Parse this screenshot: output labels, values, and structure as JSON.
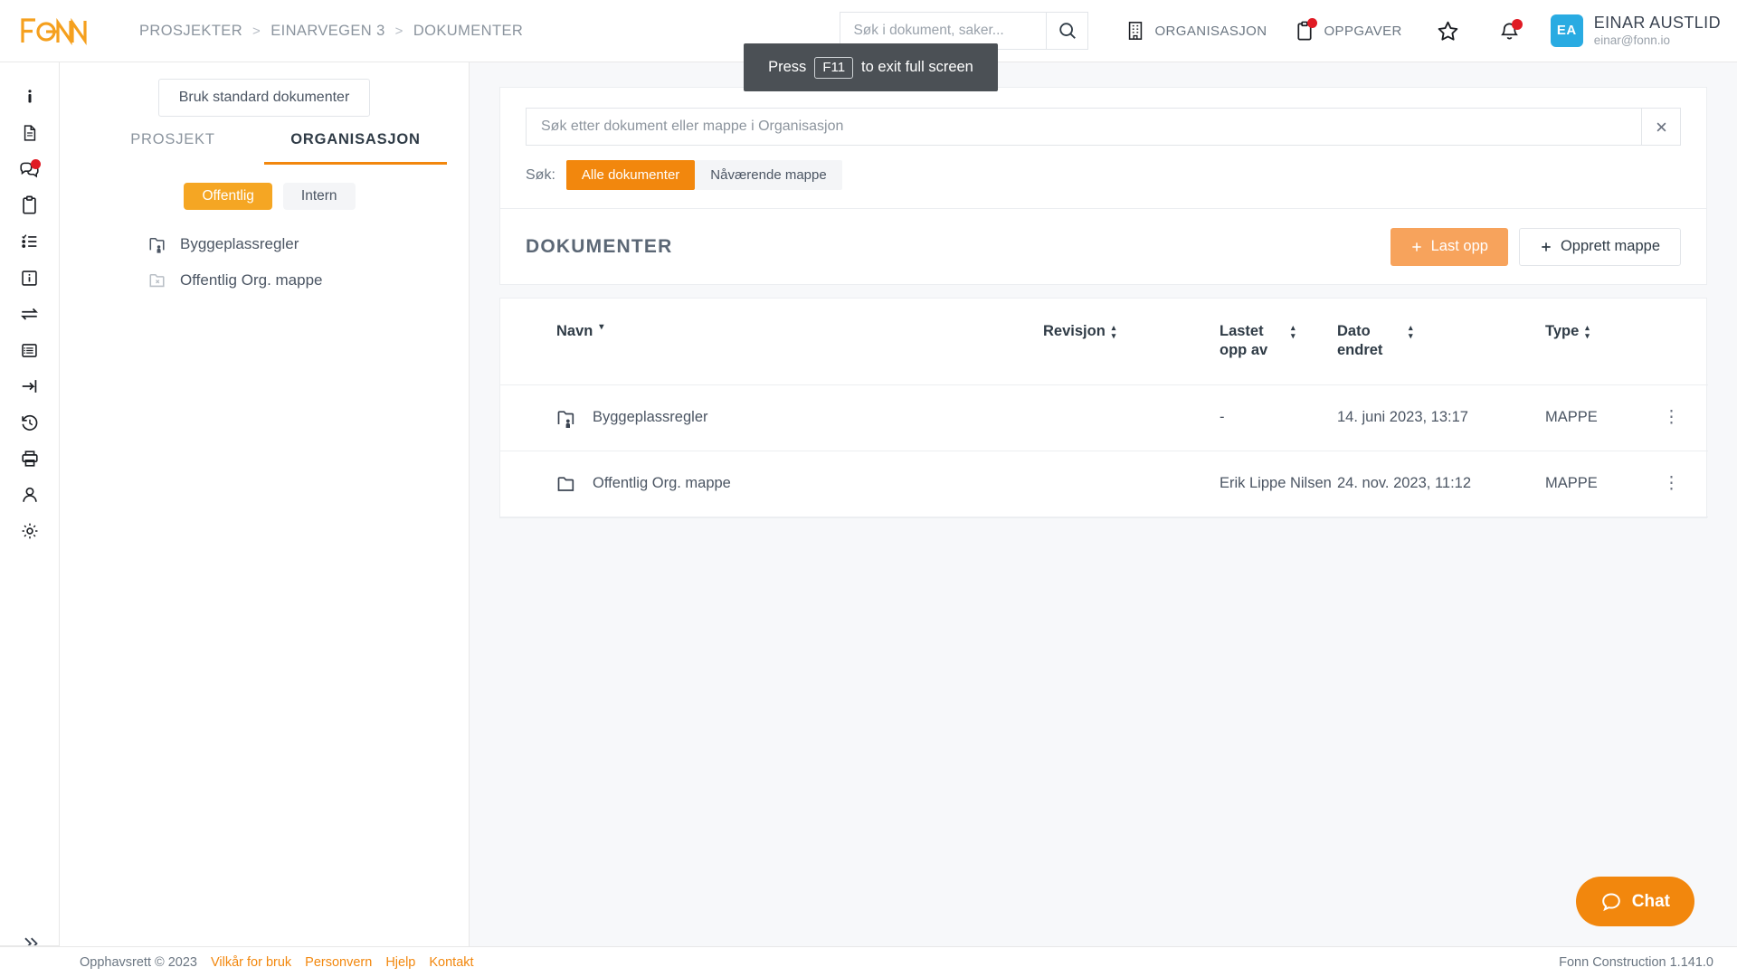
{
  "brand": {
    "logo_text": "FONN",
    "accent": "#f2870d",
    "accent_light": "#f7a35c",
    "avatar_color": "#29abe2"
  },
  "header": {
    "breadcrumb": [
      {
        "label": "PROSJEKTER"
      },
      {
        "label": "EINARVEGEN 3"
      },
      {
        "label": "DOKUMENTER"
      }
    ],
    "separator": ">",
    "search": {
      "placeholder": "Søk i dokument, saker...",
      "value": ""
    },
    "nav": [
      {
        "label": "ORGANISASJON",
        "icon": "building-icon",
        "badge": false
      },
      {
        "label": "OPPGAVER",
        "icon": "clipboard-icon",
        "badge": true
      }
    ],
    "favorites_icon": "star-icon",
    "notifications_icon": "bell-icon",
    "notifications_badge": true,
    "user": {
      "initials": "EA",
      "name": "EINAR AUSTLID",
      "email": "einar@fonn.io"
    }
  },
  "fullscreen_toast": {
    "prefix": "Press",
    "key": "F11",
    "suffix": "to exit full screen"
  },
  "rail": {
    "items": [
      {
        "icon": "info-icon",
        "badge": false
      },
      {
        "icon": "document-icon",
        "badge": false
      },
      {
        "icon": "chat-bubbles-icon",
        "badge": true
      },
      {
        "icon": "clipboard-icon",
        "badge": false
      },
      {
        "icon": "checklist-icon",
        "badge": false
      },
      {
        "icon": "info-box-icon",
        "badge": false
      },
      {
        "icon": "transfer-arrows-icon",
        "badge": false
      },
      {
        "icon": "table-list-icon",
        "badge": false
      },
      {
        "icon": "login-arrow-icon",
        "badge": false
      },
      {
        "icon": "history-icon",
        "badge": false
      },
      {
        "icon": "printer-icon",
        "badge": false
      },
      {
        "icon": "person-icon",
        "badge": false
      },
      {
        "icon": "gear-icon",
        "badge": false
      }
    ],
    "expand_icon": "chevron-double-right-icon"
  },
  "left_panel": {
    "standard_button": "Bruk standard dokumenter",
    "tabs": [
      {
        "label": "PROSJEKT",
        "active": false
      },
      {
        "label": "ORGANISASJON",
        "active": true
      }
    ],
    "pills": [
      {
        "label": "Offentlig",
        "active": true
      },
      {
        "label": "Intern",
        "active": false
      }
    ],
    "tree": [
      {
        "label": "Byggeplassregler",
        "icon": "folder-person-icon"
      },
      {
        "label": "Offentlig Org. mappe",
        "icon": "folder-restricted-icon"
      }
    ]
  },
  "main": {
    "search": {
      "placeholder": "Søk etter dokument eller mappe i Organisasjon",
      "value": "",
      "clear_icon": "close-icon"
    },
    "filter": {
      "label": "Søk:",
      "options": [
        {
          "label": "Alle dokumenter",
          "active": true
        },
        {
          "label": "Nåværende mappe",
          "active": false
        }
      ]
    },
    "section_title": "DOKUMENTER",
    "actions": [
      {
        "label": "Last opp",
        "style": "primary",
        "icon": "plus-icon"
      },
      {
        "label": "Opprett mappe",
        "style": "outline",
        "icon": "plus-icon"
      }
    ],
    "table": {
      "columns": [
        {
          "label": "Navn",
          "sort": "desc"
        },
        {
          "label": "Revisjon",
          "sort": "both"
        },
        {
          "label": "Lastet opp av",
          "sort": "both"
        },
        {
          "label": "Dato endret",
          "sort": "both"
        },
        {
          "label": "Type",
          "sort": "both"
        }
      ],
      "rows": [
        {
          "icon": "folder-person-icon",
          "name": "Byggeplassregler",
          "revisjon": "",
          "lastet_opp_av": "-",
          "dato_endret": "14. juni 2023, 13:17",
          "type": "MAPPE",
          "menu_icon": "kebab-menu-icon"
        },
        {
          "icon": "folder-icon",
          "name": "Offentlig Org. mappe",
          "revisjon": "",
          "lastet_opp_av": "Erik Lippe Nilsen",
          "dato_endret": "24. nov. 2023, 11:12",
          "type": "MAPPE",
          "menu_icon": "kebab-menu-icon"
        }
      ]
    }
  },
  "chat": {
    "label": "Chat",
    "icon": "chat-bubble-icon"
  },
  "footer": {
    "copyright": "Opphavsrett © 2023",
    "links": [
      {
        "label": "Vilkår for bruk"
      },
      {
        "label": "Personvern"
      },
      {
        "label": "Hjelp"
      },
      {
        "label": "Kontakt"
      }
    ],
    "version": "Fonn Construction 1.141.0"
  }
}
